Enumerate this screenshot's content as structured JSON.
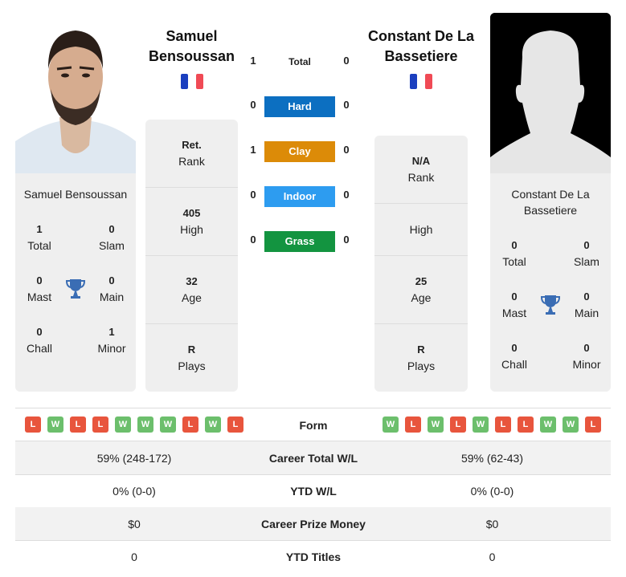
{
  "colors": {
    "hard": "#0c6fc1",
    "clay": "#dc8b08",
    "indoor": "#2d9cf0",
    "grass": "#139440",
    "win": "#6cbf6c",
    "loss": "#e8553d",
    "flag_blue": "#1b3fbf",
    "flag_red": "#f04a55",
    "trophy": "#3a6db4"
  },
  "player1": {
    "name_header_line1": "Samuel",
    "name_header_line2": "Bensoussan",
    "card_name": "Samuel Bensoussan",
    "country": "France",
    "titles": {
      "total": {
        "value": "1",
        "label": "Total"
      },
      "slam": {
        "value": "0",
        "label": "Slam"
      },
      "mast": {
        "value": "0",
        "label": "Mast"
      },
      "main": {
        "value": "0",
        "label": "Main"
      },
      "chall": {
        "value": "0",
        "label": "Chall"
      },
      "minor": {
        "value": "1",
        "label": "Minor"
      }
    },
    "info": {
      "rank": {
        "value": "Ret.",
        "label": "Rank"
      },
      "high": {
        "value": "405",
        "label": "High"
      },
      "age": {
        "value": "32",
        "label": "Age"
      },
      "plays": {
        "value": "R",
        "label": "Plays"
      }
    },
    "form": [
      "L",
      "W",
      "L",
      "L",
      "W",
      "W",
      "W",
      "L",
      "W",
      "L"
    ]
  },
  "player2": {
    "name_header_line1": "Constant De La",
    "name_header_line2": "Bassetiere",
    "card_name_line1": "Constant De La",
    "card_name_line2": "Bassetiere",
    "country": "France",
    "titles": {
      "total": {
        "value": "0",
        "label": "Total"
      },
      "slam": {
        "value": "0",
        "label": "Slam"
      },
      "mast": {
        "value": "0",
        "label": "Mast"
      },
      "main": {
        "value": "0",
        "label": "Main"
      },
      "chall": {
        "value": "0",
        "label": "Chall"
      },
      "minor": {
        "value": "0",
        "label": "Minor"
      }
    },
    "info": {
      "rank": {
        "value": "N/A",
        "label": "Rank"
      },
      "high": {
        "value": "",
        "label": "High"
      },
      "age": {
        "value": "25",
        "label": "Age"
      },
      "plays": {
        "value": "R",
        "label": "Plays"
      }
    },
    "form": [
      "W",
      "L",
      "W",
      "L",
      "W",
      "L",
      "L",
      "W",
      "W",
      "L"
    ]
  },
  "h2h": {
    "total": {
      "label": "Total",
      "p1": "1",
      "p2": "0"
    },
    "surfaces": [
      {
        "label": "Hard",
        "p1": "0",
        "p2": "0",
        "color_key": "hard"
      },
      {
        "label": "Clay",
        "p1": "1",
        "p2": "0",
        "color_key": "clay"
      },
      {
        "label": "Indoor",
        "p1": "0",
        "p2": "0",
        "color_key": "indoor"
      },
      {
        "label": "Grass",
        "p1": "0",
        "p2": "0",
        "color_key": "grass"
      }
    ]
  },
  "comparison": {
    "form_label": "Form",
    "rows": [
      {
        "label": "Career Total W/L",
        "p1": "59% (248-172)",
        "p2": "59% (62-43)"
      },
      {
        "label": "YTD W/L",
        "p1": "0% (0-0)",
        "p2": "0% (0-0)"
      },
      {
        "label": "Career Prize Money",
        "p1": "$0",
        "p2": "$0"
      },
      {
        "label": "YTD Titles",
        "p1": "0",
        "p2": "0"
      }
    ]
  }
}
